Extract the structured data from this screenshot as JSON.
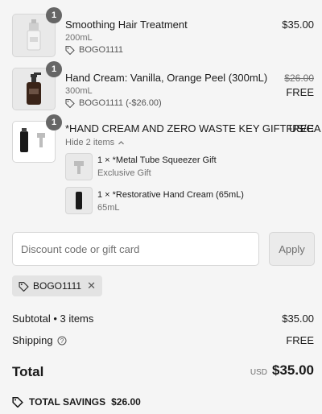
{
  "items": [
    {
      "qty": "1",
      "name": "Smoothing Hair Treatment",
      "variant": "200mL",
      "discount": "BOGO1111",
      "price": "$35.00"
    },
    {
      "qty": "1",
      "name": "Hand Cream: Vanilla, Orange Peel (300mL)",
      "variant": "300mL",
      "discount": "BOGO1111 (-$26.00)",
      "original_price": "$26.00",
      "price": "FREE"
    },
    {
      "qty": "1",
      "name": "*HAND CREAM AND ZERO WASTE KEY GIFT US/CA",
      "toggle_label": "Hide 2 items",
      "price": "FREE",
      "components": [
        {
          "name": "1 × *Metal Tube Squeezer Gift",
          "meta": "Exclusive Gift"
        },
        {
          "name": "1 × *Restorative Hand Cream (65mL)",
          "meta": "65mL"
        }
      ]
    }
  ],
  "discount_form": {
    "placeholder": "Discount code or gift card",
    "apply_label": "Apply",
    "applied_code": "BOGO1111"
  },
  "summary": {
    "subtotal_label": "Subtotal • 3 items",
    "subtotal_value": "$35.00",
    "shipping_label": "Shipping",
    "shipping_value": "FREE",
    "total_label": "Total",
    "currency": "USD",
    "total_value": "$35.00",
    "savings_label": "TOTAL SAVINGS",
    "savings_value": "$26.00"
  },
  "icons": [
    "tag-icon",
    "chevron-up-icon",
    "info-icon",
    "close-icon"
  ]
}
